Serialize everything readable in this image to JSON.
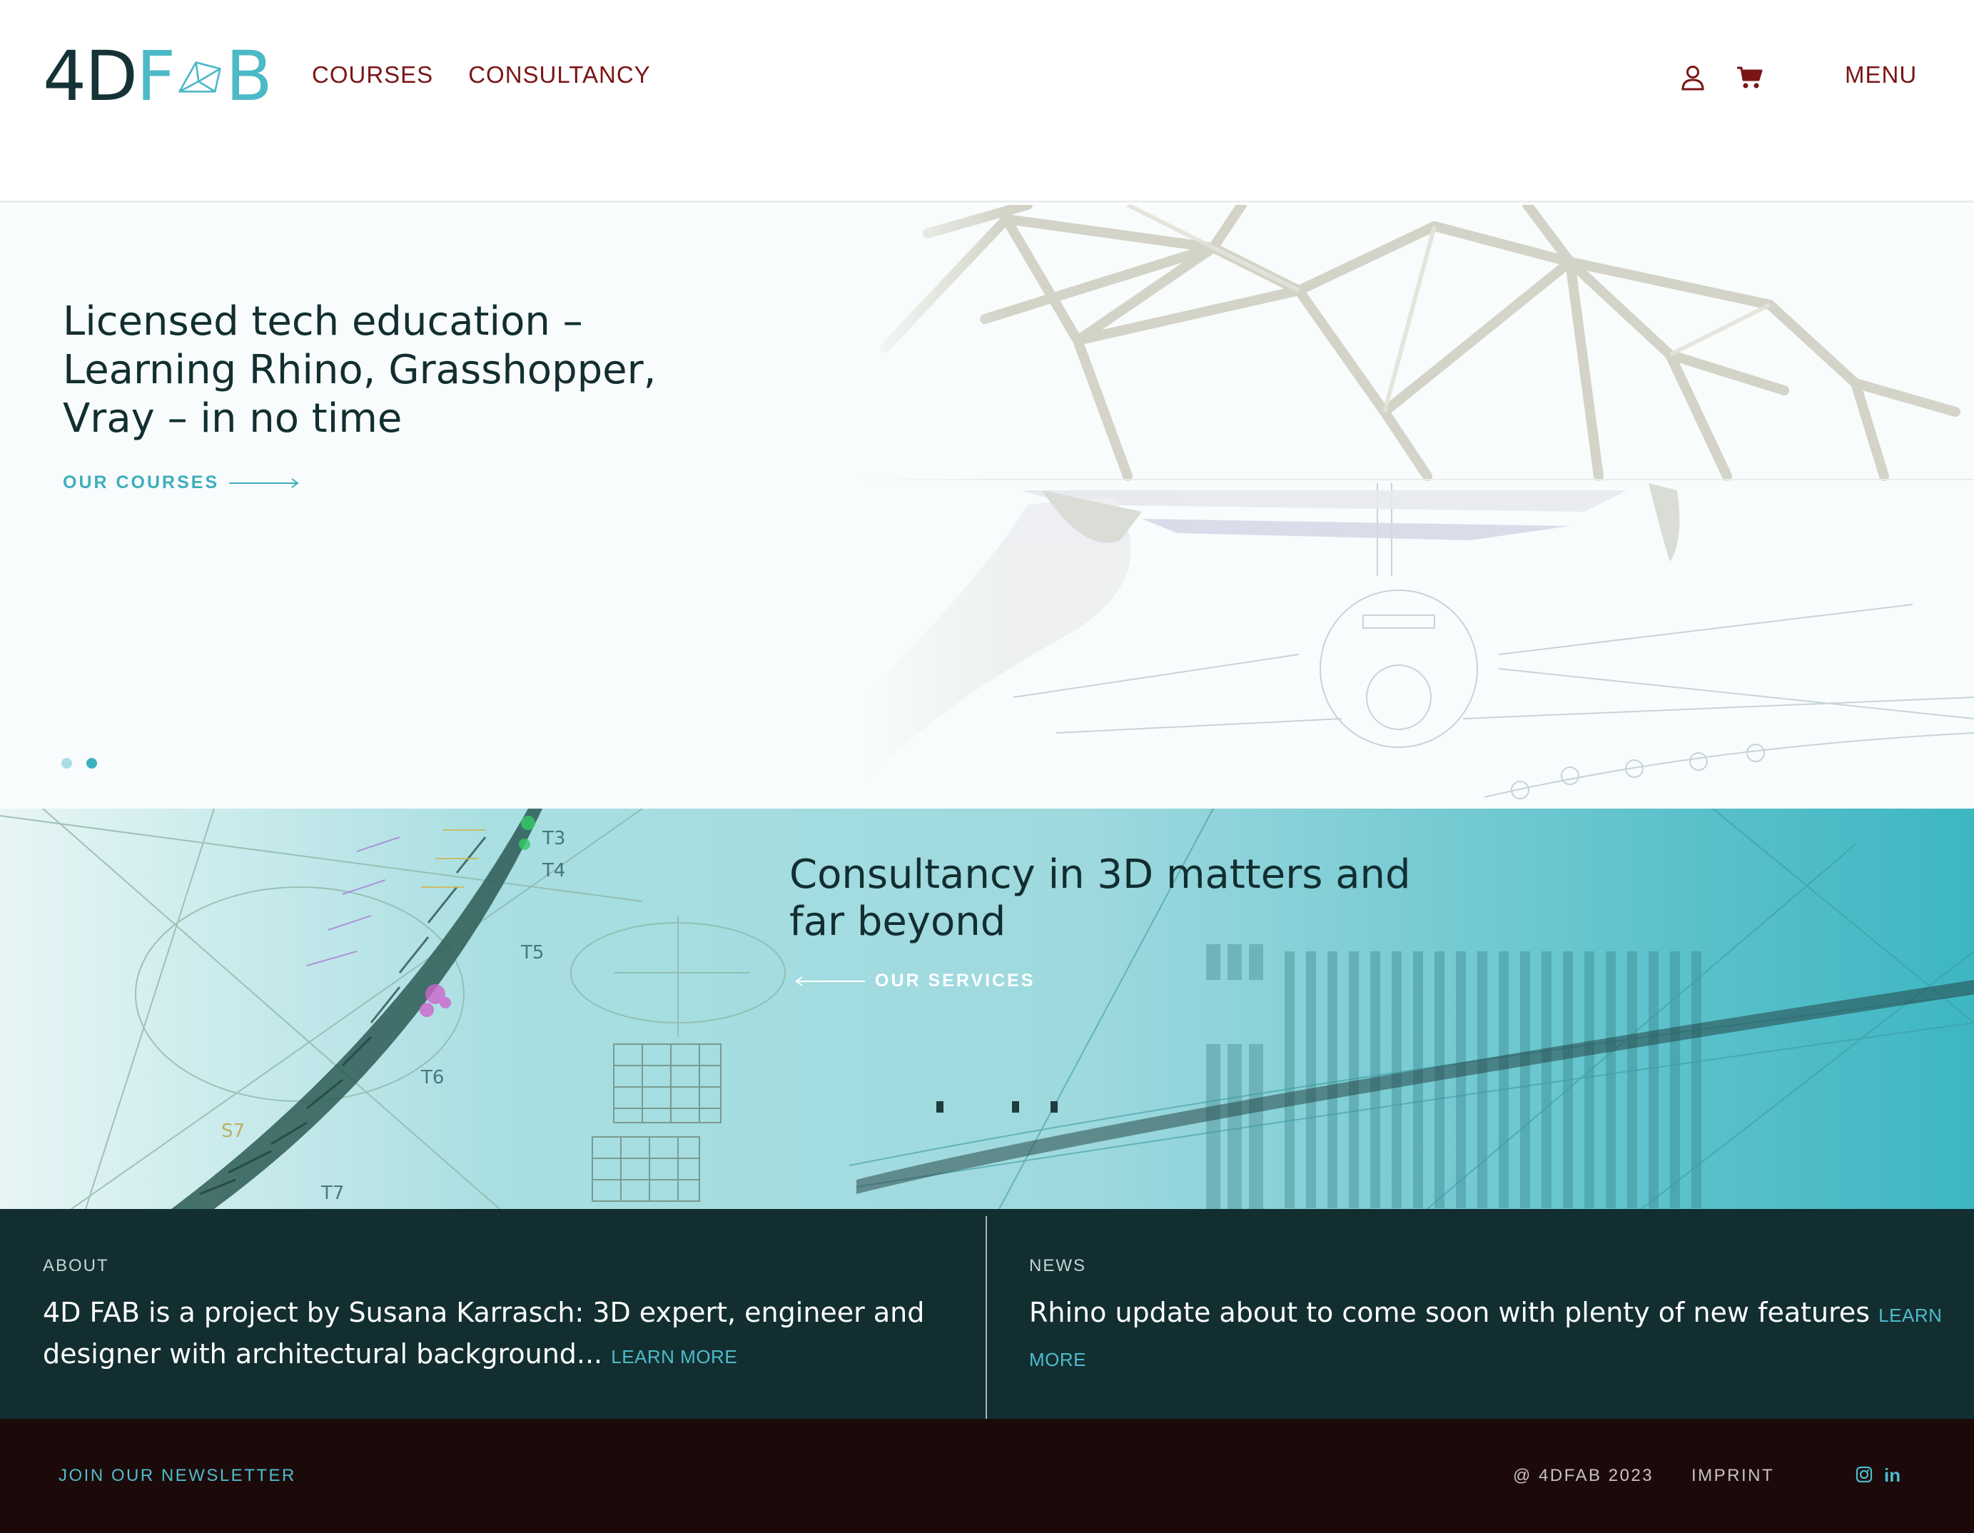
{
  "header": {
    "logo": {
      "part1": "4D",
      "part2": "F",
      "part3": "B"
    },
    "nav": [
      {
        "label": "COURSES"
      },
      {
        "label": "CONSULTANCY"
      }
    ],
    "icons": [
      "user-icon",
      "cart-icon"
    ],
    "menu_label": "MENU"
  },
  "hero": {
    "title": "Licensed tech education – Learning Rhino, Grasshopper, Vray – in no time",
    "cta_label": "OUR COURSES",
    "slides": {
      "count": 2,
      "active_index": 1
    }
  },
  "consultancy": {
    "title": "Consultancy in 3D matters and far beyond",
    "cta_label": "OUR SERVICES"
  },
  "about": {
    "label": "ABOUT",
    "text": "4D FAB is a project by Susana Karrasch: 3D expert, engineer and designer with architectural background...",
    "learn_more": "LEARN MORE"
  },
  "news": {
    "label": "NEWS",
    "text": "Rhino update about to come soon with plenty of new features",
    "learn_more": "LEARN MORE"
  },
  "footer": {
    "newsletter": "JOIN OUR NEWSLETTER",
    "copyright": "@ 4DFAB 2023",
    "imprint": "IMPRINT",
    "social_icons": [
      "instagram-icon",
      "linkedin-icon"
    ],
    "linkedin_glyph": "in"
  },
  "colors": {
    "brand_dark": "#122e31",
    "brand_teal": "#4cb9c6",
    "nav_red": "#7a1515",
    "footer_bg": "#1c0a0b"
  }
}
